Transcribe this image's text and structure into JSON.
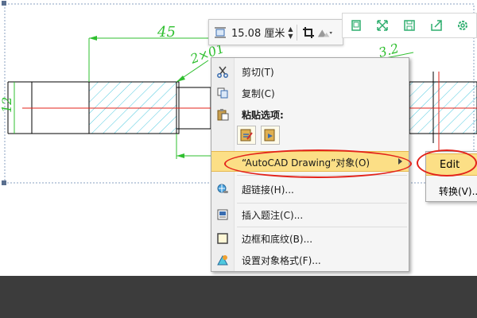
{
  "drawing": {
    "dim_45": "45",
    "dim_2x01": "2×01",
    "dim_32": "3.2",
    "dim_12": "12"
  },
  "size_toolbar": {
    "value": "15.08 厘米",
    "spin_up": "▲",
    "spin_down": "▼"
  },
  "context_menu": {
    "items": [
      {
        "label": "剪切(T)",
        "icon": "scissors-icon"
      },
      {
        "label": "复制(C)",
        "icon": "copy-icon"
      },
      {
        "label": "粘贴选项:",
        "icon": "paste-icon"
      },
      {
        "label": "“AutoCAD Drawing”对象(O)",
        "icon": ""
      },
      {
        "label": "超链接(H)...",
        "icon": "hyperlink-icon"
      },
      {
        "label": "插入题注(C)...",
        "icon": "caption-icon"
      },
      {
        "label": "边框和底纹(B)...",
        "icon": "border-icon"
      },
      {
        "label": "设置对象格式(F)...",
        "icon": "format-object-icon"
      }
    ]
  },
  "sub_menu": {
    "items": [
      {
        "label": "Edit"
      },
      {
        "label": "转换(V)..."
      }
    ]
  },
  "colors": {
    "highlight": "#fcdf86",
    "annotation_red": "#e3231b",
    "hatch_cyan": "#4ec9df",
    "dim_green": "#2fbf2f"
  }
}
